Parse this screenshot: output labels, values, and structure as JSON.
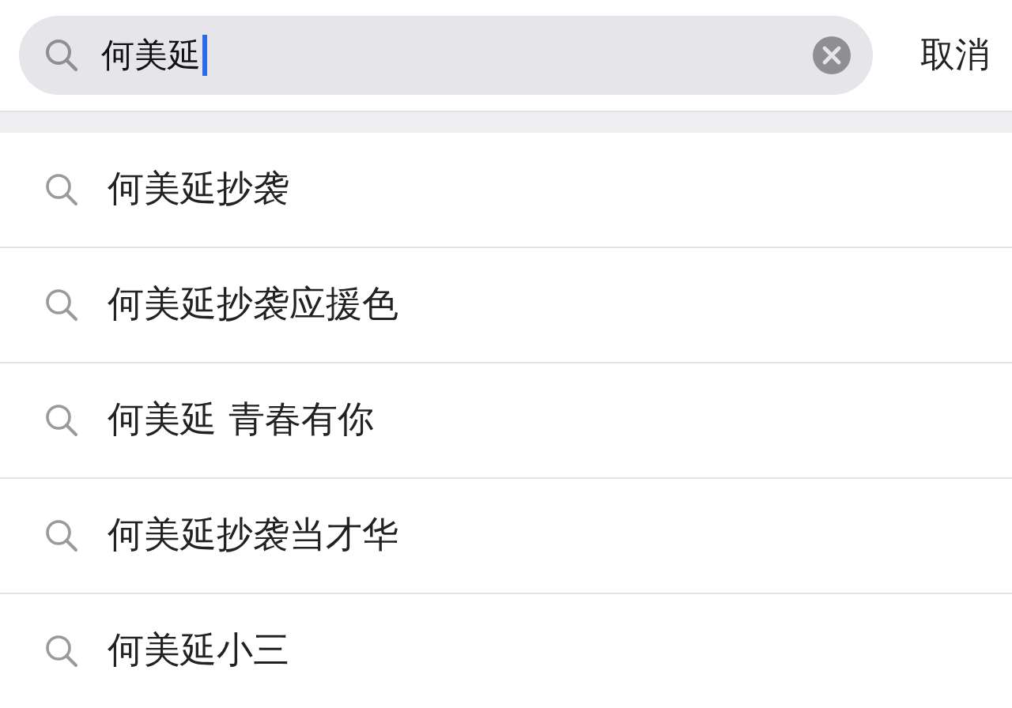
{
  "search": {
    "value": "何美延",
    "cancel": "取消"
  },
  "suggestions": [
    {
      "text": "何美延抄袭"
    },
    {
      "text": "何美延抄袭应援色"
    },
    {
      "text": "何美延 青春有你"
    },
    {
      "text": "何美延抄袭当才华"
    },
    {
      "text": "何美延小三"
    }
  ]
}
